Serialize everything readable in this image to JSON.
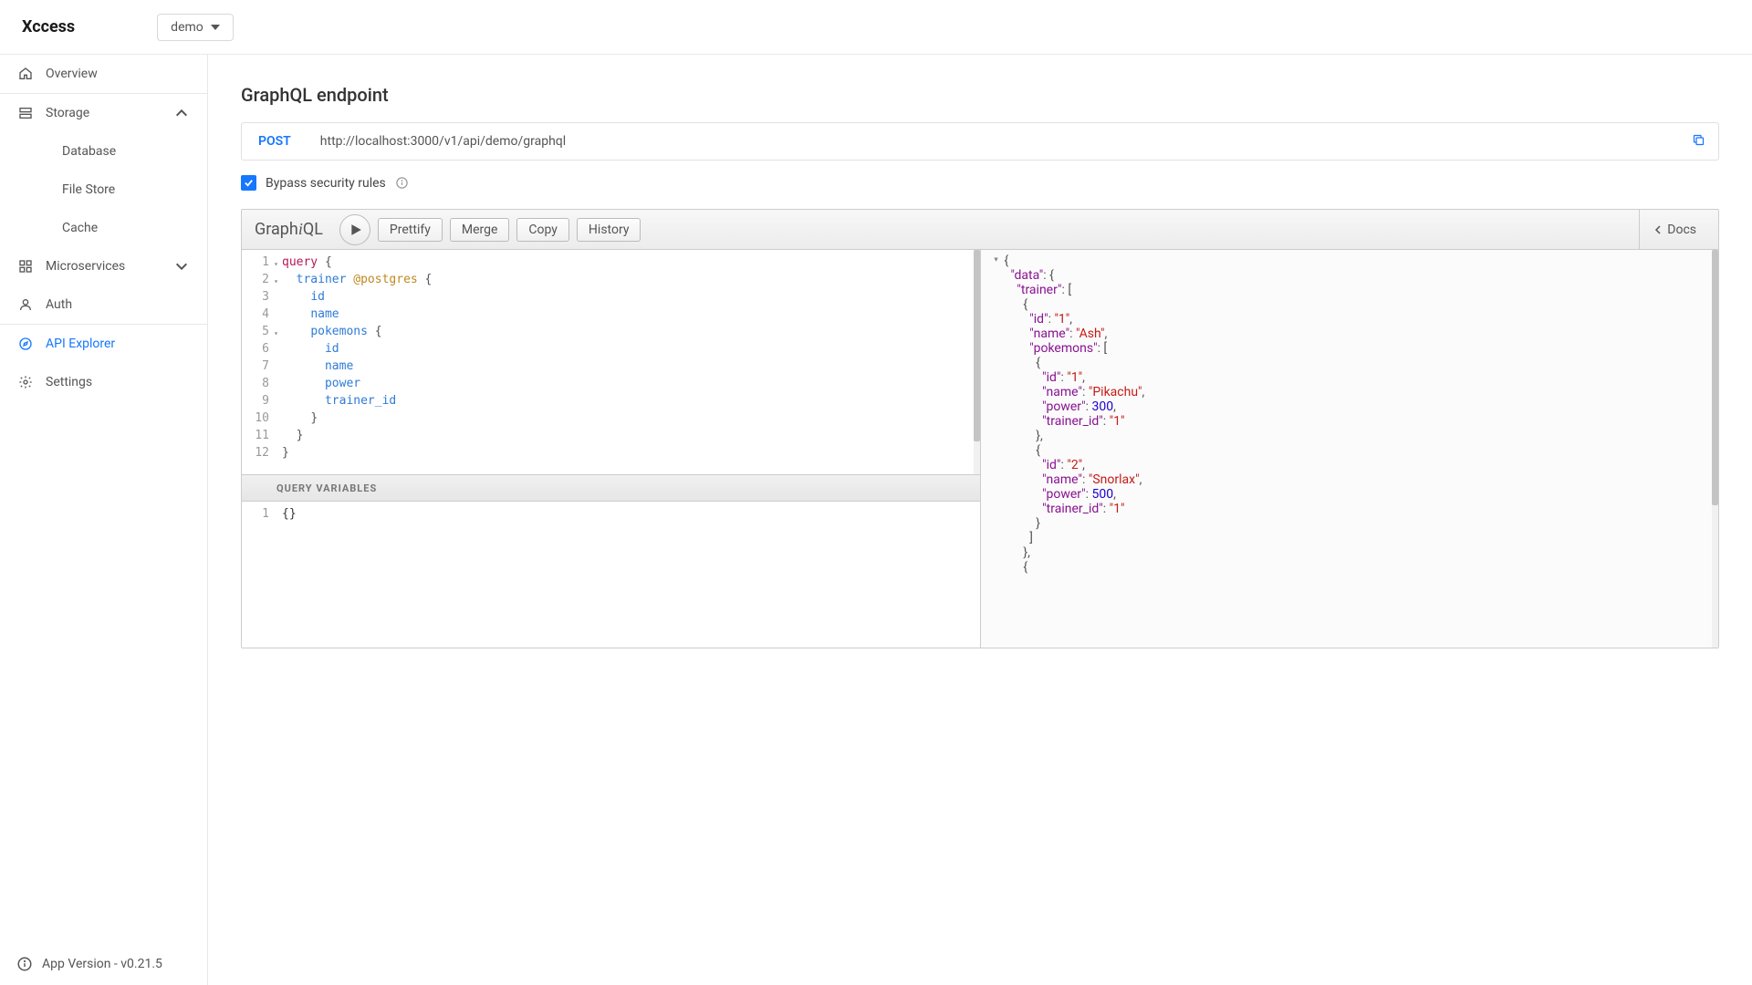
{
  "header": {
    "logo": "Xccess",
    "project": "demo"
  },
  "sidebar": {
    "items": {
      "overview": "Overview",
      "storage": "Storage",
      "database": "Database",
      "file_store": "File Store",
      "cache": "Cache",
      "microservices": "Microservices",
      "auth": "Auth",
      "api_explorer": "API Explorer",
      "settings": "Settings"
    },
    "version": "App Version - v0.21.5"
  },
  "page": {
    "title": "GraphQL endpoint",
    "method": "POST",
    "url": "http://localhost:3000/v1/api/demo/graphql",
    "bypass_label": "Bypass security rules"
  },
  "graphiql": {
    "logo": "GraphiQL",
    "buttons": {
      "prettify": "Prettify",
      "merge": "Merge",
      "copy": "Copy",
      "history": "History",
      "docs": "Docs"
    },
    "query_variables_label": "QUERY VARIABLES",
    "variables_value": "{}",
    "query_lines": [
      {
        "n": 1,
        "fold": true,
        "tokens": [
          [
            "c-kw",
            "query"
          ],
          [
            "c-punc",
            " {"
          ]
        ],
        "indent": 0
      },
      {
        "n": 2,
        "fold": true,
        "tokens": [
          [
            "c-def",
            "trainer "
          ],
          [
            "c-dir",
            "@postgres"
          ],
          [
            "c-punc",
            " {"
          ]
        ],
        "indent": 1
      },
      {
        "n": 3,
        "fold": false,
        "tokens": [
          [
            "c-attr",
            "id"
          ]
        ],
        "indent": 2
      },
      {
        "n": 4,
        "fold": false,
        "tokens": [
          [
            "c-attr",
            "name"
          ]
        ],
        "indent": 2
      },
      {
        "n": 5,
        "fold": true,
        "tokens": [
          [
            "c-def",
            "pokemons"
          ],
          [
            "c-punc",
            " {"
          ]
        ],
        "indent": 2
      },
      {
        "n": 6,
        "fold": false,
        "tokens": [
          [
            "c-attr",
            "id"
          ]
        ],
        "indent": 3
      },
      {
        "n": 7,
        "fold": false,
        "tokens": [
          [
            "c-attr",
            "name"
          ]
        ],
        "indent": 3
      },
      {
        "n": 8,
        "fold": false,
        "tokens": [
          [
            "c-attr",
            "power"
          ]
        ],
        "indent": 3
      },
      {
        "n": 9,
        "fold": false,
        "tokens": [
          [
            "c-attr",
            "trainer_id"
          ]
        ],
        "indent": 3
      },
      {
        "n": 10,
        "fold": false,
        "tokens": [
          [
            "c-punc",
            "}"
          ]
        ],
        "indent": 2
      },
      {
        "n": 11,
        "fold": false,
        "tokens": [
          [
            "c-punc",
            "}"
          ]
        ],
        "indent": 1
      },
      {
        "n": 12,
        "fold": false,
        "tokens": [
          [
            "c-punc",
            "}"
          ]
        ],
        "indent": 0
      }
    ],
    "result_lines": [
      {
        "fold": true,
        "tokens": [
          [
            "c-punc",
            "{"
          ]
        ],
        "indent": 0
      },
      {
        "fold": true,
        "tokens": [
          [
            "c-key",
            "\"data\""
          ],
          [
            "c-punc",
            ": {"
          ]
        ],
        "indent": 1
      },
      {
        "fold": true,
        "tokens": [
          [
            "c-key",
            "\"trainer\""
          ],
          [
            "c-punc",
            ": ["
          ]
        ],
        "indent": 2
      },
      {
        "fold": true,
        "tokens": [
          [
            "c-punc",
            "{"
          ]
        ],
        "indent": 3
      },
      {
        "fold": false,
        "tokens": [
          [
            "c-key",
            "\"id\""
          ],
          [
            "c-punc",
            ": "
          ],
          [
            "c-str",
            "\"1\""
          ],
          [
            "c-punc",
            ","
          ]
        ],
        "indent": 4
      },
      {
        "fold": false,
        "tokens": [
          [
            "c-key",
            "\"name\""
          ],
          [
            "c-punc",
            ": "
          ],
          [
            "c-str",
            "\"Ash\""
          ],
          [
            "c-punc",
            ","
          ]
        ],
        "indent": 4
      },
      {
        "fold": true,
        "tokens": [
          [
            "c-key",
            "\"pokemons\""
          ],
          [
            "c-punc",
            ": ["
          ]
        ],
        "indent": 4
      },
      {
        "fold": true,
        "tokens": [
          [
            "c-punc",
            "{"
          ]
        ],
        "indent": 5
      },
      {
        "fold": false,
        "tokens": [
          [
            "c-key",
            "\"id\""
          ],
          [
            "c-punc",
            ": "
          ],
          [
            "c-str",
            "\"1\""
          ],
          [
            "c-punc",
            ","
          ]
        ],
        "indent": 6
      },
      {
        "fold": false,
        "tokens": [
          [
            "c-key",
            "\"name\""
          ],
          [
            "c-punc",
            ": "
          ],
          [
            "c-str",
            "\"Pikachu\""
          ],
          [
            "c-punc",
            ","
          ]
        ],
        "indent": 6
      },
      {
        "fold": false,
        "tokens": [
          [
            "c-key",
            "\"power\""
          ],
          [
            "c-punc",
            ": "
          ],
          [
            "c-num",
            "300"
          ],
          [
            "c-punc",
            ","
          ]
        ],
        "indent": 6
      },
      {
        "fold": false,
        "tokens": [
          [
            "c-key",
            "\"trainer_id\""
          ],
          [
            "c-punc",
            ": "
          ],
          [
            "c-str",
            "\"1\""
          ]
        ],
        "indent": 6
      },
      {
        "fold": false,
        "tokens": [
          [
            "c-punc",
            "},"
          ]
        ],
        "indent": 5
      },
      {
        "fold": true,
        "tokens": [
          [
            "c-punc",
            "{"
          ]
        ],
        "indent": 5
      },
      {
        "fold": false,
        "tokens": [
          [
            "c-key",
            "\"id\""
          ],
          [
            "c-punc",
            ": "
          ],
          [
            "c-str",
            "\"2\""
          ],
          [
            "c-punc",
            ","
          ]
        ],
        "indent": 6
      },
      {
        "fold": false,
        "tokens": [
          [
            "c-key",
            "\"name\""
          ],
          [
            "c-punc",
            ": "
          ],
          [
            "c-str",
            "\"Snorlax\""
          ],
          [
            "c-punc",
            ","
          ]
        ],
        "indent": 6
      },
      {
        "fold": false,
        "tokens": [
          [
            "c-key",
            "\"power\""
          ],
          [
            "c-punc",
            ": "
          ],
          [
            "c-num",
            "500"
          ],
          [
            "c-punc",
            ","
          ]
        ],
        "indent": 6
      },
      {
        "fold": false,
        "tokens": [
          [
            "c-key",
            "\"trainer_id\""
          ],
          [
            "c-punc",
            ": "
          ],
          [
            "c-str",
            "\"1\""
          ]
        ],
        "indent": 6
      },
      {
        "fold": false,
        "tokens": [
          [
            "c-punc",
            "}"
          ]
        ],
        "indent": 5
      },
      {
        "fold": false,
        "tokens": [
          [
            "c-punc",
            "]"
          ]
        ],
        "indent": 4
      },
      {
        "fold": false,
        "tokens": [
          [
            "c-punc",
            "},"
          ]
        ],
        "indent": 3
      },
      {
        "fold": true,
        "tokens": [
          [
            "c-punc",
            "{"
          ]
        ],
        "indent": 3
      }
    ]
  }
}
